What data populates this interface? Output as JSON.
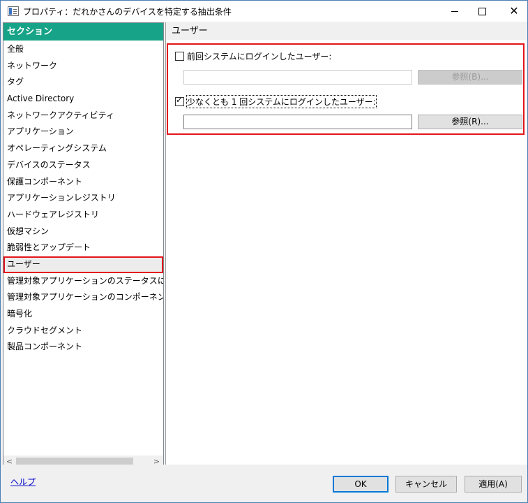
{
  "window": {
    "title": "プロパティ：だれかさんのデバイスを特定する抽出条件",
    "controls": {
      "minimize": "—",
      "maximize": "☐",
      "close": "✕"
    }
  },
  "left": {
    "section_header": "セクション",
    "items": [
      {
        "label": "全般"
      },
      {
        "label": "ネットワーク"
      },
      {
        "label": "タグ"
      },
      {
        "label": "Active Directory"
      },
      {
        "label": "ネットワークアクティビティ"
      },
      {
        "label": "アプリケーション"
      },
      {
        "label": "オペレーティングシステム"
      },
      {
        "label": "デバイスのステータス"
      },
      {
        "label": "保護コンポーネント"
      },
      {
        "label": "アプリケーションレジストリ"
      },
      {
        "label": "ハードウェアレジストリ"
      },
      {
        "label": "仮想マシン"
      },
      {
        "label": "脆弱性とアップデート"
      },
      {
        "label": "ユーザー",
        "selected": true
      },
      {
        "label": "管理対象アプリケーションのステータスに影響があ"
      },
      {
        "label": "管理対象アプリケーションのコンポーネントのステ-"
      },
      {
        "label": "暗号化"
      },
      {
        "label": "クラウドセグメント"
      },
      {
        "label": "製品コンポーネント"
      }
    ],
    "scroll_left": "<",
    "scroll_right": ">"
  },
  "main": {
    "title": "ユーザー",
    "option1": {
      "label": "前回システムにログインしたユーザー:",
      "checked": false,
      "value": "",
      "browse_label": "参照(B)..."
    },
    "option2": {
      "label": "少なくとも 1 回システムにログインしたユーザー:",
      "checked": true,
      "value": "",
      "browse_label": "参照(R)..."
    }
  },
  "footer": {
    "help_label": "ヘルプ",
    "ok_label": "OK",
    "cancel_label": "キャンセル",
    "apply_label": "適用(A)"
  },
  "colors": {
    "accent": "#17a387",
    "highlight": "#e3141b",
    "link": "#0000cc"
  }
}
